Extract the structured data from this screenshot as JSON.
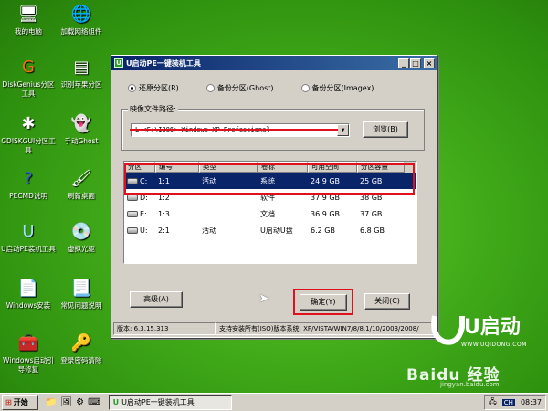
{
  "desktop_icons": [
    {
      "label": "我的电脑",
      "icon": "computer-icon"
    },
    {
      "label": "加载网络组件",
      "icon": "network-globe-icon"
    },
    {
      "label": "DiskGenius分区工具",
      "icon": "diskgenius-icon"
    },
    {
      "label": "识别苹果分区",
      "icon": "apple-partition-icon"
    },
    {
      "label": "GDISKGUI分区工具",
      "icon": "gdisk-icon"
    },
    {
      "label": "手动Ghost",
      "icon": "ghost-icon"
    },
    {
      "label": "PECMD说明",
      "icon": "help-icon"
    },
    {
      "label": "刷新桌面",
      "icon": "refresh-desktop-icon"
    },
    {
      "label": "U启动PE装机工具",
      "icon": "u-install-icon"
    },
    {
      "label": "虚拟光驱",
      "icon": "virtual-drive-icon"
    },
    {
      "label": "Windows安装",
      "icon": "windows-install-icon"
    },
    {
      "label": "常见问题说明",
      "icon": "faq-icon"
    },
    {
      "label": "Windows启动引导修复",
      "icon": "boot-repair-icon"
    },
    {
      "label": "登录密码清除",
      "icon": "key-icon"
    }
  ],
  "window": {
    "title": "U启动PE一键装机工具",
    "radios": [
      {
        "label": "还原分区(R)",
        "checked": true
      },
      {
        "label": "备份分区(Ghost)",
        "checked": false
      },
      {
        "label": "备份分区(Imagex)",
        "checked": false
      }
    ],
    "image_group_label": "映像文件路径:",
    "image_path": "L <F:\\I386> Windows XP Professional",
    "browse_label": "浏览(B)",
    "columns": [
      "分区",
      "编号",
      "类型",
      "卷标",
      "可用空间",
      "分区容量"
    ],
    "rows": [
      {
        "drive": "C:",
        "num": "1:1",
        "type": "活动",
        "label": "系统",
        "free": "24.9 GB",
        "size": "25 GB",
        "selected": true
      },
      {
        "drive": "D:",
        "num": "1:2",
        "type": "",
        "label": "软件",
        "free": "37.9 GB",
        "size": "38 GB",
        "selected": false
      },
      {
        "drive": "E:",
        "num": "1:3",
        "type": "",
        "label": "文档",
        "free": "36.9 GB",
        "size": "37 GB",
        "selected": false
      },
      {
        "drive": "U:",
        "num": "2:1",
        "type": "活动",
        "label": "U启动U盘",
        "free": "6.2 GB",
        "size": "6.8 GB",
        "selected": false
      }
    ],
    "advanced_label": "高级(A)",
    "ok_label": "确定(Y)",
    "close_label": "关闭(C)",
    "status": {
      "version": "版本: 6.3.15.313",
      "support": "支持安装所有(ISO)版本系统: XP/VISTA/WIN7/8/8.1/10/2003/2008/"
    }
  },
  "taskbar": {
    "start_label": "开始",
    "task_label": "U启动PE一键装机工具",
    "ime": "CH",
    "clock": "08:37"
  },
  "watermark": {
    "logo_text": "U启动",
    "logo_url": "WWW.UQIDONG.COM",
    "baidu": "Baidu 经验",
    "baidu_url": "jingyan.baidu.com"
  },
  "colors": {
    "accent": "#0a246a",
    "highlight": "#e0101f",
    "desktop": "#3fa818"
  }
}
